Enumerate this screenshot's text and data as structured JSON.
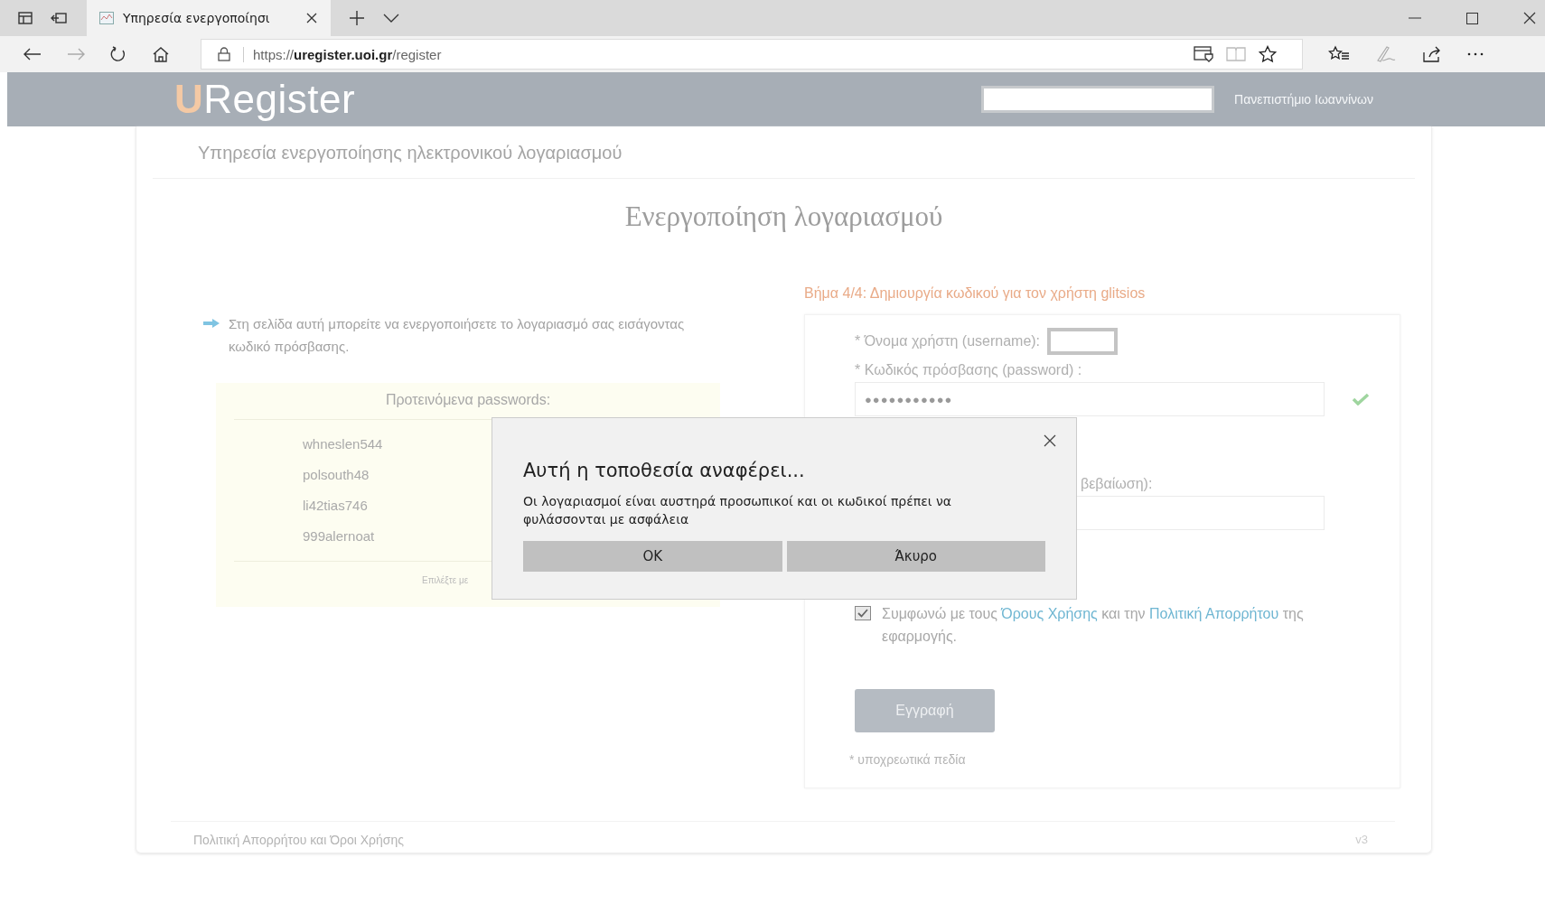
{
  "browser": {
    "tab": {
      "title": "Υπηρεσία ενεργοποίησι",
      "selected": true
    },
    "url": "https://**uregister.uoi.gr**/register"
  },
  "header": {
    "logo_initial": "U",
    "logo_rest": "Register",
    "institution": "Πανεπιστήμιο Ιωαννίνων"
  },
  "page": {
    "subtitle": "Υπηρεσία ενεργοποίησης ηλεκτρονικού λογαριασμού",
    "heading": "Ενεργοποίηση λογαριασμού",
    "intro": "Στη σελίδα αυτή μπορείτε να ενεργοποιήσετε το λογαριασμό σας εισάγοντας κωδικό πρόσβασης.",
    "suggestions": {
      "title": "Προτεινόμενα passwords:",
      "items": [
        "whneslen544",
        "polsouth48",
        "li42tias746",
        "999alernoat"
      ],
      "hint": "Επιλέξτε με"
    },
    "step": "Βήμα 4/4: Δημιουργία κωδικού για τον χρήστη glitsios",
    "form": {
      "username_label": "* Όνομα χρήστη (username):",
      "password_label": "* Κωδικός πρόσβασης (password) :",
      "password_value": "●●●●●●●●●●●",
      "password_valid": true,
      "confirm_label_visible": "βεβαίωση):",
      "terms": {
        "checked": true,
        "before": "Συμφωνώ με τους",
        "link1": "Όρους Χρήσης",
        "middle": "και την",
        "link2": "Πολιτική Απορρήτου",
        "after": "της εφαρμογής."
      },
      "submit": "Εγγραφή",
      "required_note": "* υποχρεωτικά πεδία"
    },
    "footer": {
      "link": "Πολιτική Απορρήτου και Όροι Χρήσης",
      "version": "v3"
    }
  },
  "dialog": {
    "title": "Αυτή η τοποθεσία αναφέρει...",
    "message": "Οι λογαριασμοί είναι αυστηρά προσωπικοί και οι κωδικοί πρέπει να φυλάσσονται με ασφάλεια",
    "buttons": [
      "OK",
      "Άκυρο"
    ]
  }
}
